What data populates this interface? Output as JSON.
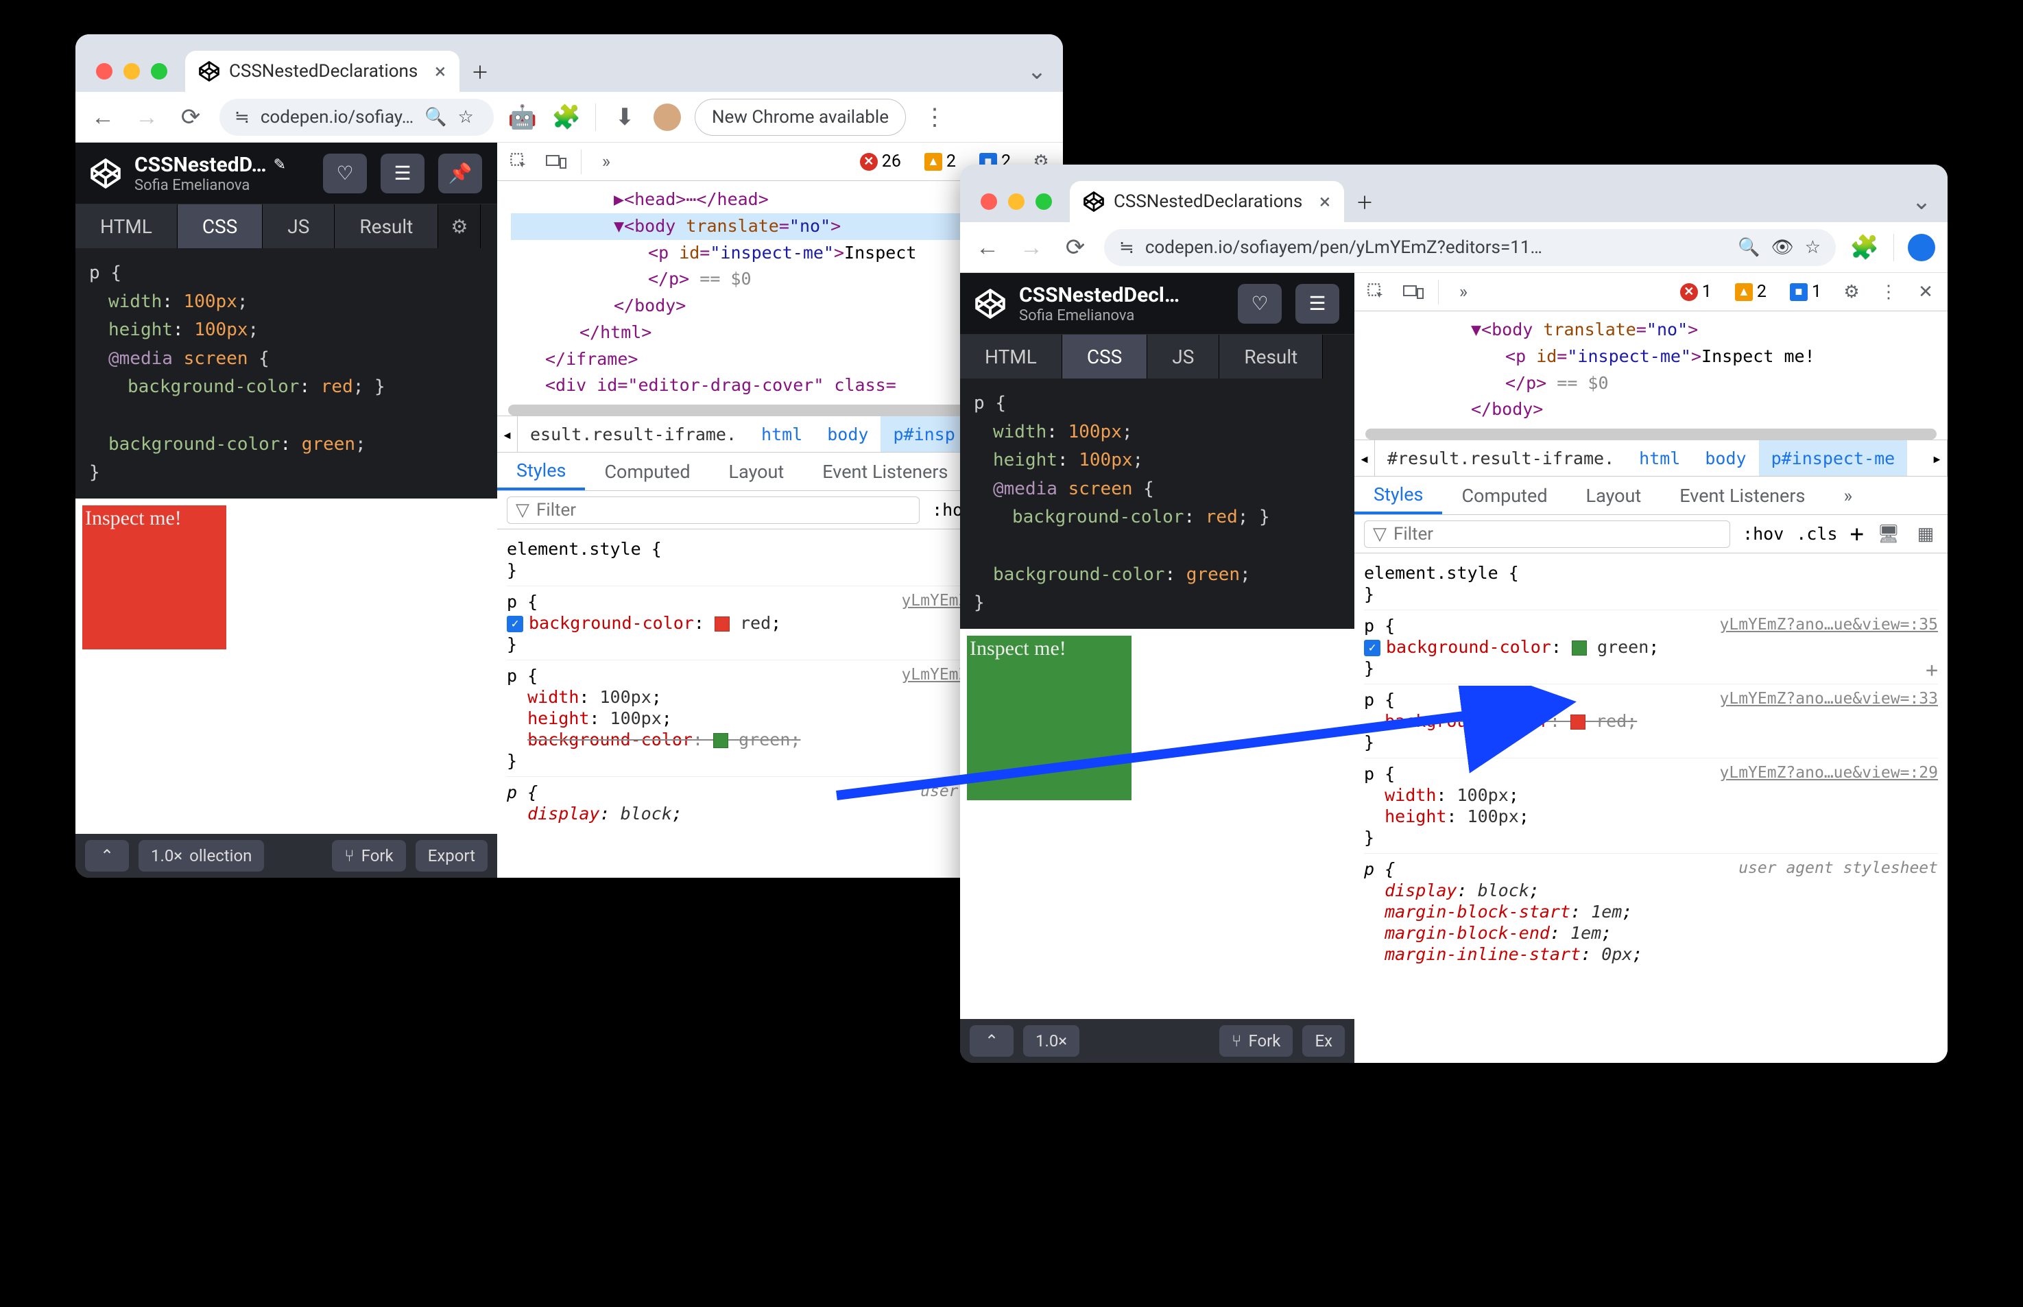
{
  "tab_title": "CSSNestedDeclarations",
  "plus": "＋",
  "url_short": "codepen.io/sofiay…",
  "url_long": "codepen.io/sofiayem/pen/yLmYEmZ?editors=11…",
  "new_chrome": "New Chrome available",
  "pen": {
    "title_trunc": "CSSNestedD…",
    "title_trunc2": "CSSNestedDecl…",
    "author": "Sofia Emelianova",
    "tab_html": "HTML",
    "tab_css": "CSS",
    "tab_js": "JS",
    "tab_result": "Result",
    "fork": "Fork",
    "export": "Export",
    "zoom": "1.0×",
    "coll": "ollection"
  },
  "css": {
    "l1": "p {",
    "l2_p": "width",
    "l2_v": "100px",
    "l3_p": "height",
    "l3_v": "100px",
    "l4_k": "@media",
    "l4_v": "screen",
    "l5_p": "background-color",
    "l5_v": "red",
    "l6_p": "background-color",
    "l6_v": "green",
    "semi": ";",
    "ob": "{",
    "cb": "}"
  },
  "inspect_text": "Inspect me!",
  "dt": {
    "err1": "26",
    "warn1": "2",
    "info1": "2",
    "err2": "1",
    "warn2": "2",
    "info2": "1",
    "styles": "Styles",
    "computed": "Computed",
    "layout": "Layout",
    "listeners": "Event Listeners",
    "filter": "Filter",
    "hov": ":hov",
    "cls": ".cls",
    "elstyle": "element.style {",
    "cb": "}",
    "src1": "yLmYEmZ?noc…ue&v",
    "src2": "yLmYEmZ?ano…ue&view=:35",
    "src3": "yLmYEmZ?ano…ue&view=:33",
    "src4": "yLmYEmZ?ano…ue&view=:29",
    "ua": "user agent stylesheet",
    "ua_short": "user agent sty",
    "prop_bg": "background-color",
    "prop_w": "width",
    "prop_h": "height",
    "prop_disp": "display",
    "prop_mbs": "margin-block-start",
    "prop_mbe": "margin-block-end",
    "prop_mis": "margin-inline-start",
    "val_red": "red",
    "val_green": "green",
    "val_100": "100px",
    "val_block": "block",
    "val_1em": "1em",
    "val_0px": "0px"
  },
  "dom1": {
    "headclose": "</head>",
    "bodyopen_tag": "body",
    "bodyopen_a": "translate",
    "bodyopen_v": "\"no\"",
    "p_tag": "p",
    "p_a": "id",
    "p_v": "\"inspect-me\"",
    "p_txt": "Inspect",
    "eq0": "== $0",
    "pclose": "</p>",
    "bodyclose": "</body>",
    "htmlclose": "</html>",
    "iframeclose": "</iframe>",
    "div_line": "<div id=\"editor-drag-cover\" class="
  },
  "dom2": {
    "p_txt": "Inspect me!"
  },
  "crumbs": {
    "pre1": "esult.result-iframe.",
    "pre2": "#result.result-iframe.",
    "html": "html",
    "body": "body",
    "p1": "p#insp",
    "p2": "p#inspect-me"
  },
  "colors": {
    "red": "#e23b2e",
    "green": "#3c8f3c"
  }
}
